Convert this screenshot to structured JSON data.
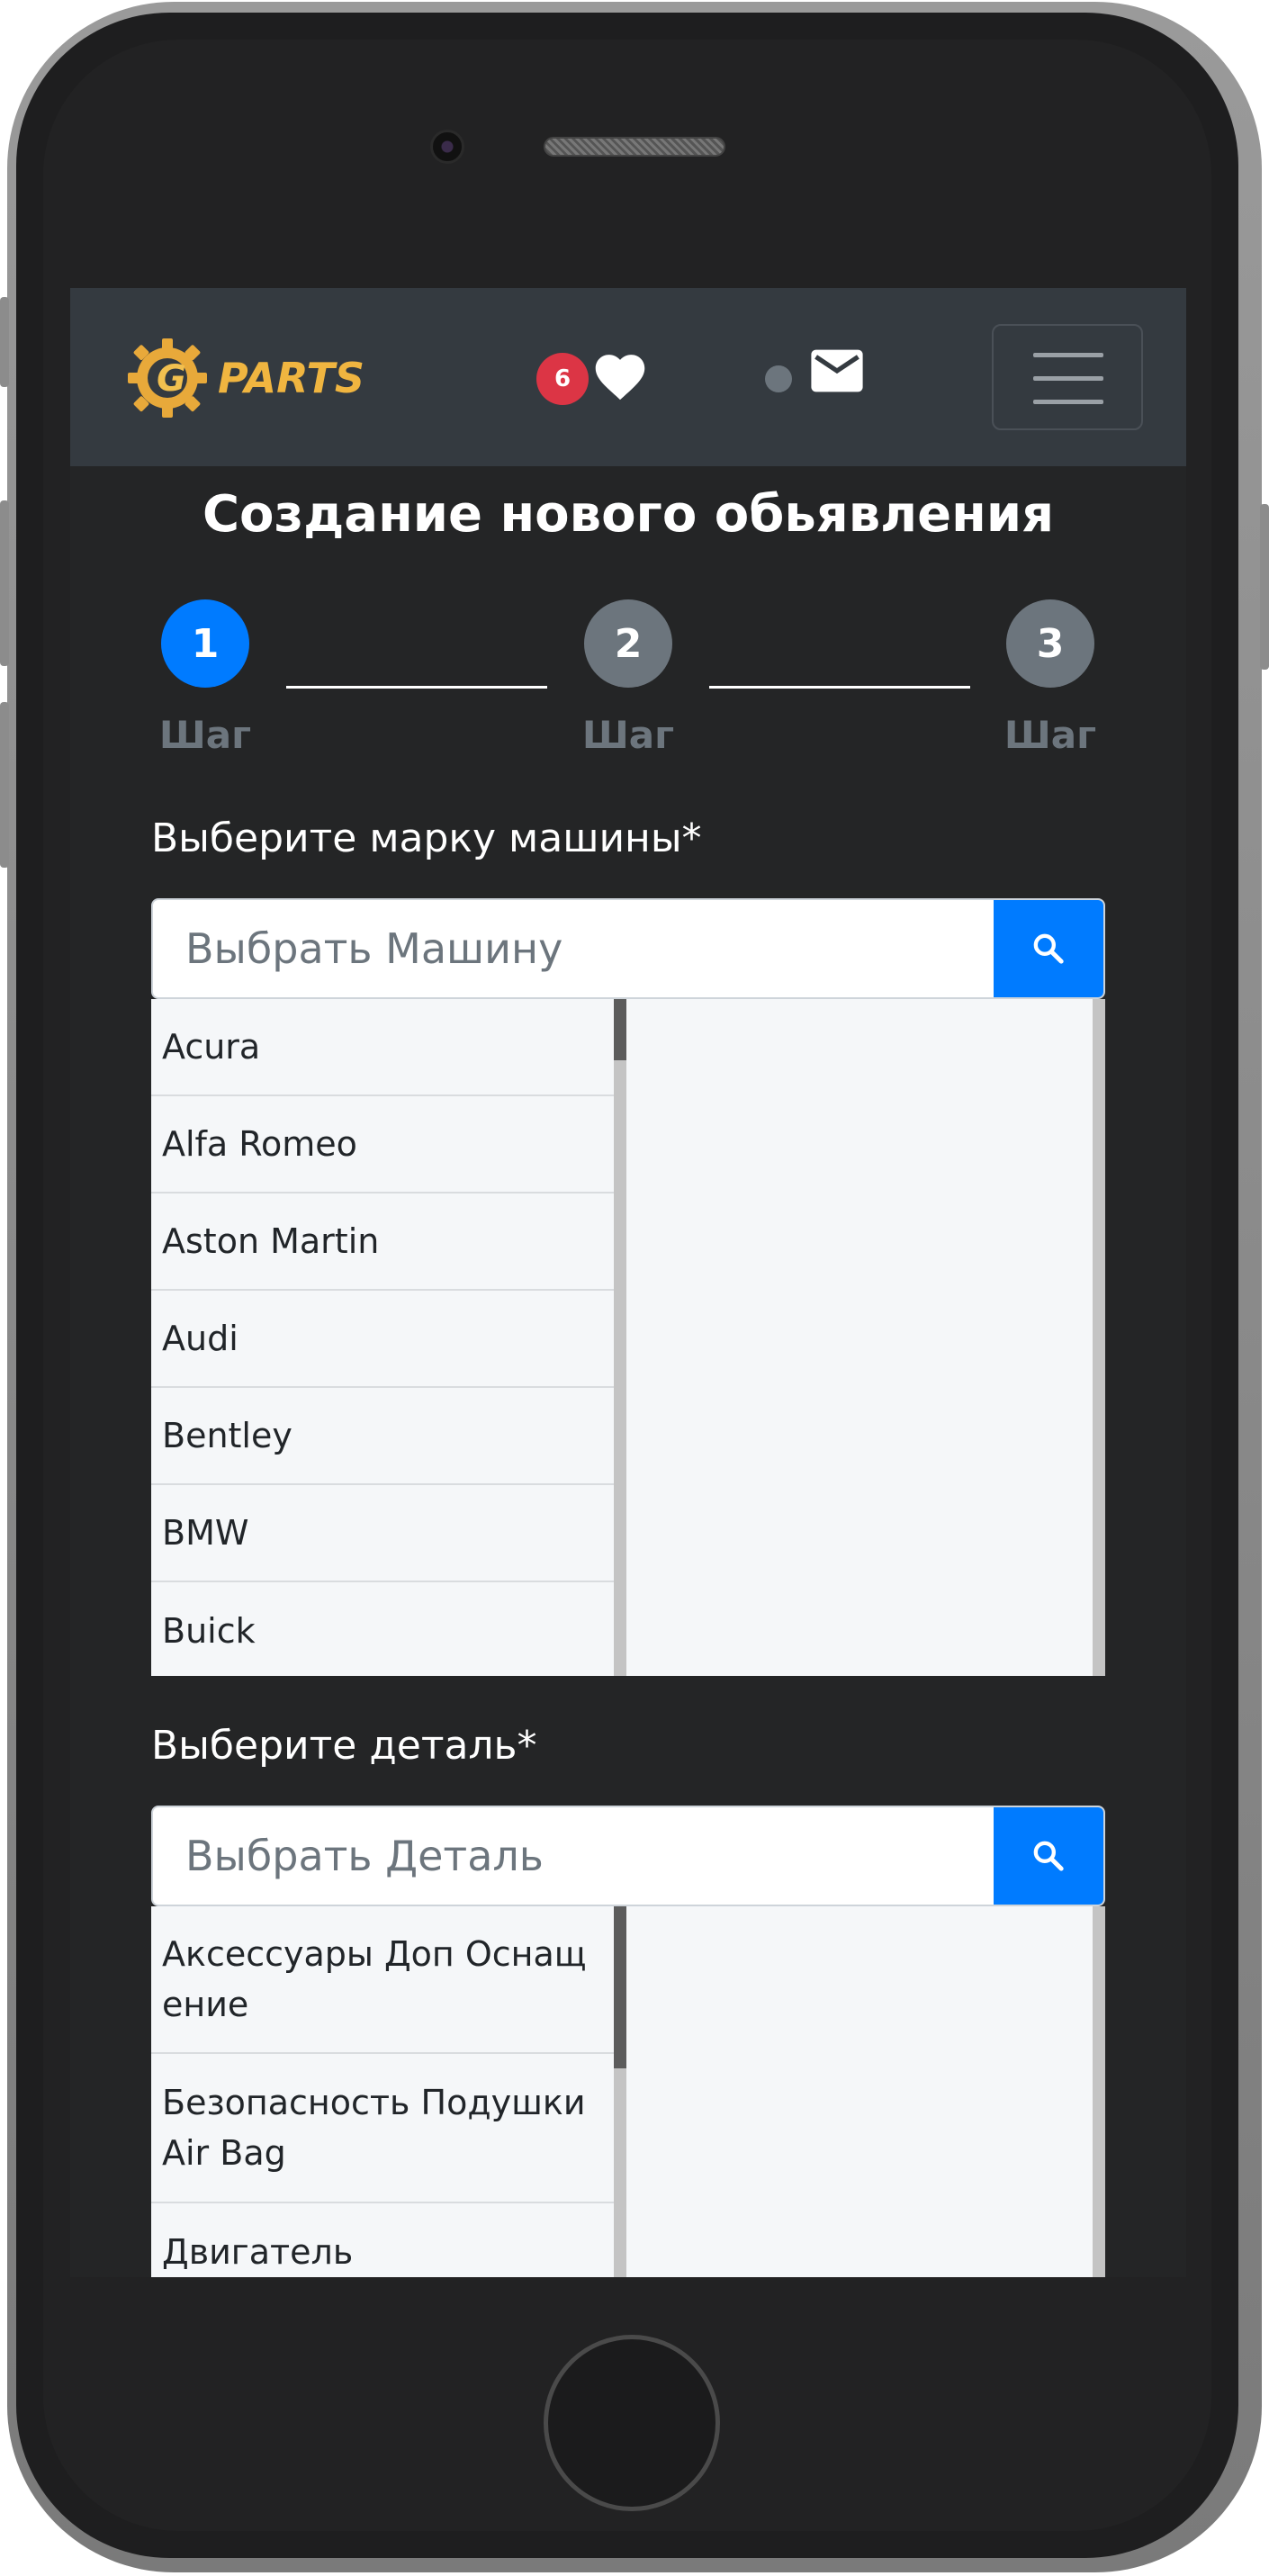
{
  "header": {
    "logo_text": "PARTS",
    "logo_letter": "G",
    "favorites_count": "6",
    "icons": [
      "heart-icon",
      "envelope-icon",
      "menu-icon",
      "search-icon"
    ]
  },
  "page": {
    "title": "Создание нового обьявления"
  },
  "steps": [
    {
      "number": "1",
      "label": "Шаг",
      "active": true
    },
    {
      "number": "2",
      "label": "Шаг",
      "active": false
    },
    {
      "number": "3",
      "label": "Шаг",
      "active": false
    }
  ],
  "car_select": {
    "label": "Выберите марку машины*",
    "placeholder": "Выбрать Машину",
    "items": [
      "Acura",
      "Alfa Romeo",
      "Aston Martin",
      "Audi",
      "Bentley",
      "BMW",
      "Buick"
    ]
  },
  "part_select": {
    "label": "Выберите деталь*",
    "placeholder": "Выбрать Деталь",
    "items": [
      "Аксессуары Доп Оснащение",
      "Безопасность Подушки Air Bag",
      "Двигатель"
    ]
  },
  "colors": {
    "primary": "#007bff",
    "navbar": "#343a40",
    "badge": "#dc3545",
    "inactive_step": "#6c757d",
    "logo_gold": "#e8a93a"
  }
}
